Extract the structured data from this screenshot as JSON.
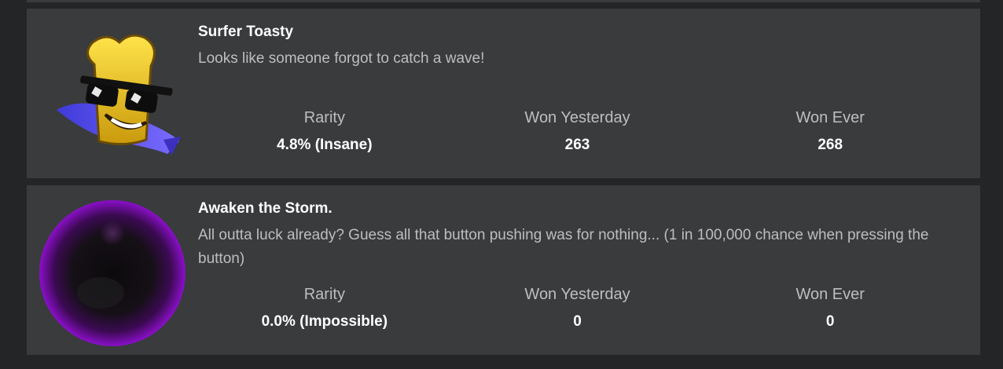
{
  "badges": [
    {
      "name": "Surfer Toasty",
      "description": "Looks like someone forgot to catch a wave!",
      "image_icon": "surfer-toasty-badge-icon",
      "stats": [
        {
          "label": "Rarity",
          "value": "4.8% (Insane)"
        },
        {
          "label": "Won Yesterday",
          "value": "263"
        },
        {
          "label": "Won Ever",
          "value": "268"
        }
      ]
    },
    {
      "name": "Awaken the Storm.",
      "description": "All outta luck already? Guess all that button pushing was for nothing... (1 in 100,000 chance when pressing the button)",
      "image_icon": "storm-orb-badge-icon",
      "stats": [
        {
          "label": "Rarity",
          "value": "0.0% (Impossible)"
        },
        {
          "label": "Won Yesterday",
          "value": "0"
        },
        {
          "label": "Won Ever",
          "value": "0"
        }
      ]
    }
  ],
  "colors": {
    "page_background": "#232527",
    "card_background": "#393b3d",
    "primary_text": "#ffffff",
    "secondary_text": "#bdbebe",
    "toast_yellow": "#f0c419",
    "surfboard_blue": "#5a4cf0",
    "storm_purple": "#8b0fc9"
  }
}
